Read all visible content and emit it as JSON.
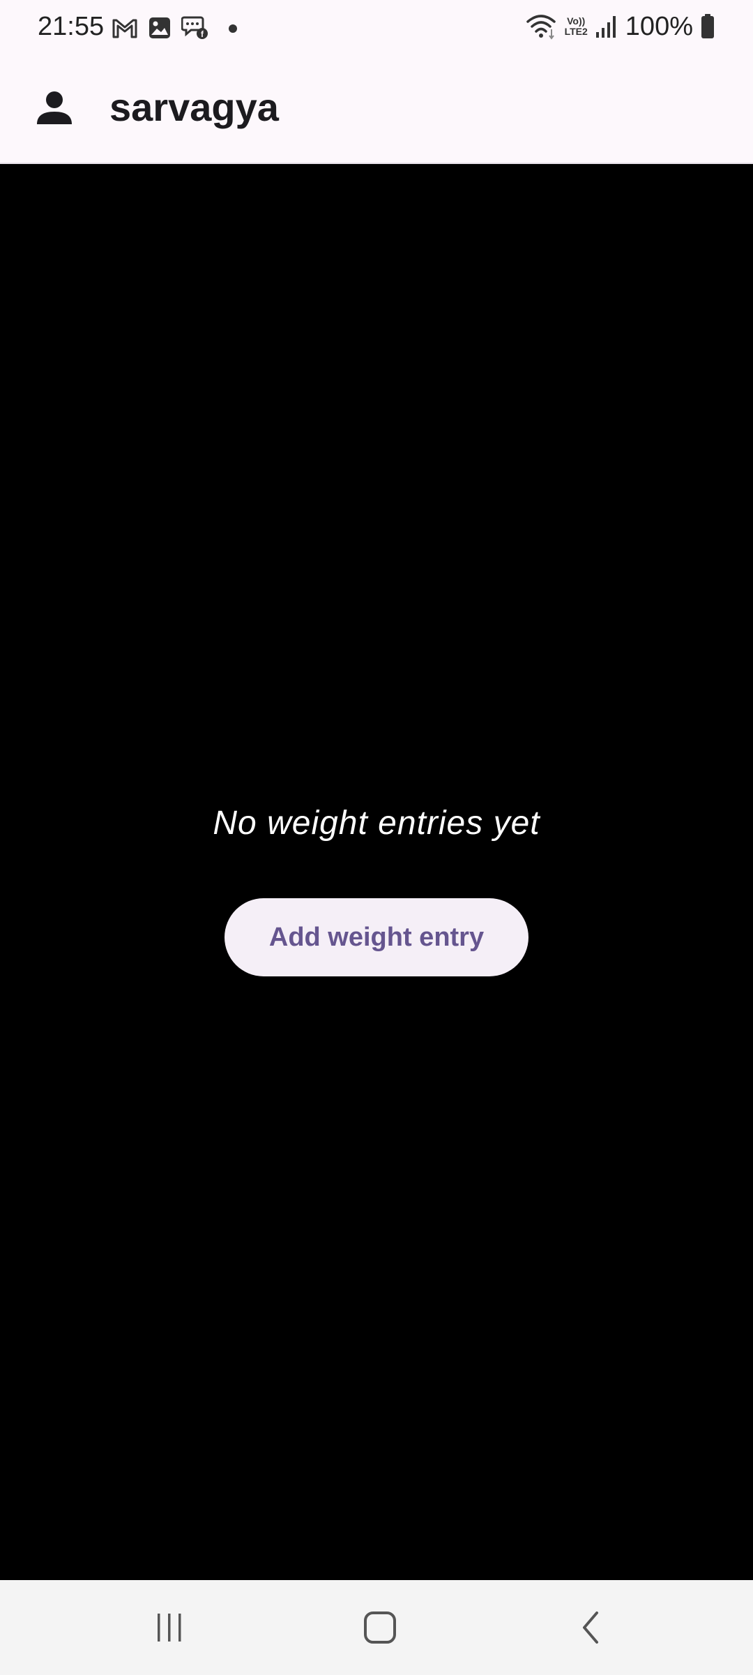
{
  "status_bar": {
    "time": "21:55",
    "left_icons": [
      "gmail-icon",
      "gallery-icon",
      "chat-icon",
      "notification-dot-icon"
    ],
    "lte_top": "Vo))",
    "lte_bottom": "LTE2",
    "battery_percent": "100%",
    "right_icons": [
      "wifi-icon",
      "signal-icon",
      "battery-icon"
    ]
  },
  "app_bar": {
    "user_name": "sarvagya",
    "profile_icon": "person-icon"
  },
  "main": {
    "empty_message": "No weight entries yet",
    "add_button_label": "Add weight entry"
  },
  "nav_bar": {
    "items": [
      "recent-apps-icon",
      "home-icon",
      "back-icon"
    ]
  },
  "colors": {
    "app_bar_bg": "#fdf8fc",
    "content_bg": "#000000",
    "button_bg": "#f5eff7",
    "button_text": "#65558f",
    "nav_bar_bg": "#f4f4f4"
  }
}
